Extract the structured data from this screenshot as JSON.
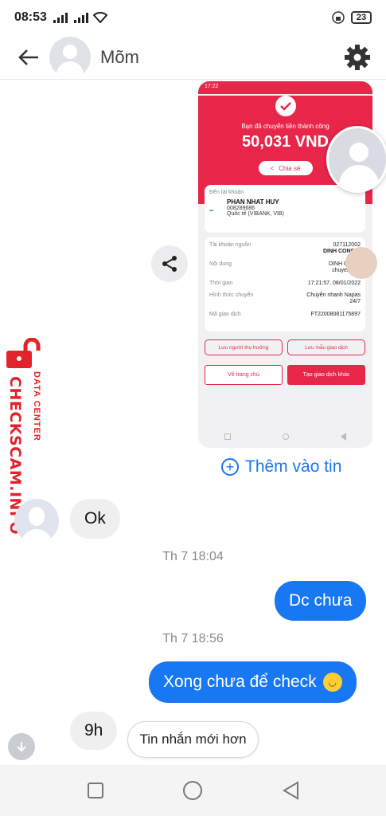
{
  "status_bar": {
    "time": "08:53",
    "battery": "23"
  },
  "header": {
    "contact_name": "Mõm"
  },
  "shared_image": {
    "status_time": "17:22",
    "success_message": "Bạn đã chuyển tiền thành công",
    "amount": "50,031 VND",
    "share_label": "Chia sẻ",
    "to_account_label": "Đến tài khoản",
    "recipient_name": "PHAN NHAT HUY",
    "recipient_number": "008289686",
    "recipient_bank": "Quốc tế (VIBANK, VIB)",
    "details": [
      {
        "label": "Tài khoản nguồn",
        "value1": "027112002",
        "value2": "DINH CONG N"
      },
      {
        "label": "Nội dung",
        "value1": "DINH CONG",
        "value2": "chuyen kho"
      },
      {
        "label": "Thời gian",
        "value1": "17:21:57, 08/01/2022",
        "value2": ""
      },
      {
        "label": "Hình thức chuyển",
        "value1": "Chuyển nhanh Napas",
        "value2": "24/7"
      },
      {
        "label": "Mã giao dịch",
        "value1": "FT22008081175897",
        "value2": ""
      }
    ],
    "btn_save_beneficiary": "Lưu người thụ hưởng",
    "btn_save_template": "Lưu mẫu giao dịch",
    "btn_home": "Về trang chủ",
    "btn_new_transaction": "Tạo giao dịch khác"
  },
  "add_to_story": "Thêm vào tin",
  "watermark": {
    "main": "CHECKSCAM.INFO",
    "sub": "DATA CENTER"
  },
  "messages": {
    "in_1": "Ok",
    "ts_1": "Th 7 18:04",
    "out_1": "Dc chưa",
    "ts_2": "Th 7 18:56",
    "out_2": "Xong chưa để check",
    "in_2": "9h"
  },
  "newer_messages": "Tin nhắn mới hơn",
  "colors": {
    "messenger_blue": "#1877f2",
    "bank_red": "#e8264a",
    "watermark_red": "#e2232a"
  }
}
